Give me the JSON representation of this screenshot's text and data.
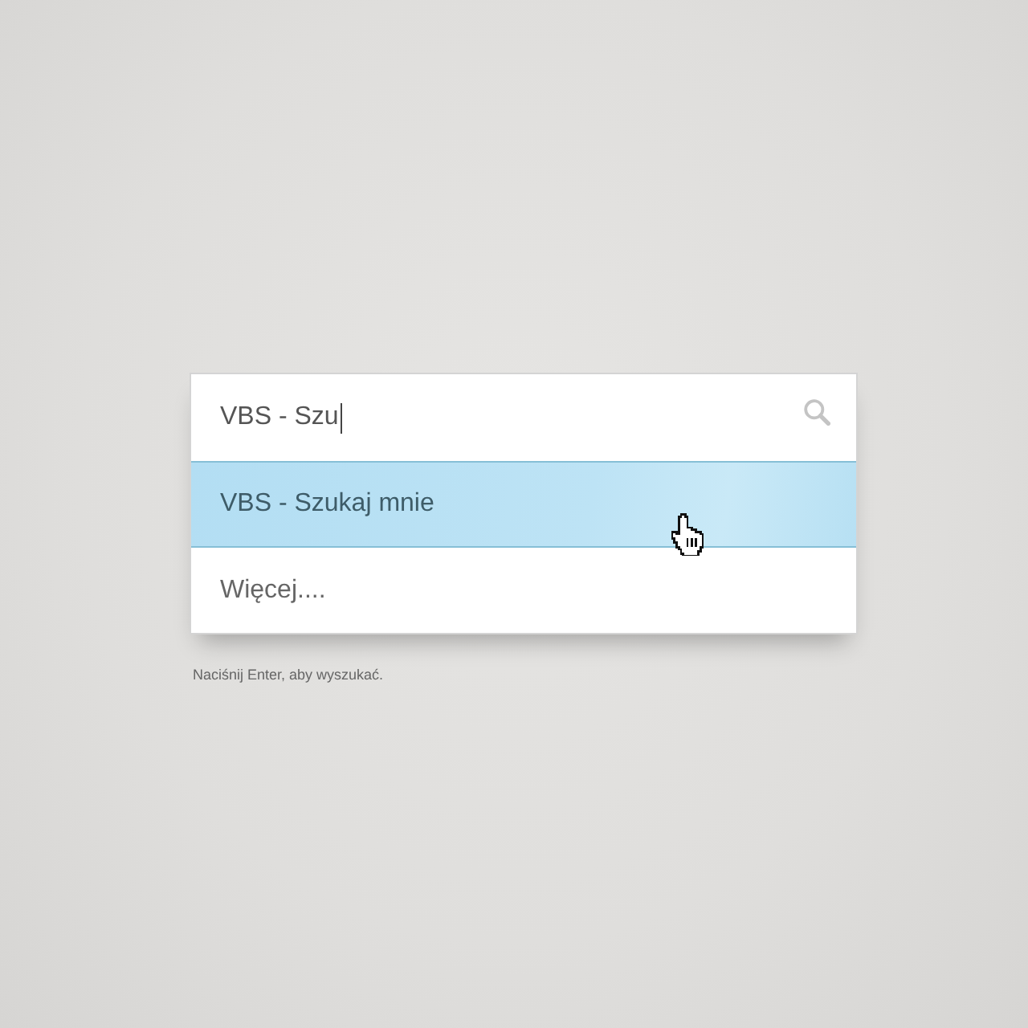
{
  "search": {
    "value": "VBS - Szu"
  },
  "suggestions": [
    {
      "label": "VBS - Szukaj mnie",
      "selected": true
    },
    {
      "label": "Więcej....",
      "selected": false
    }
  ],
  "hint": "Naciśnij Enter, aby wyszukać."
}
